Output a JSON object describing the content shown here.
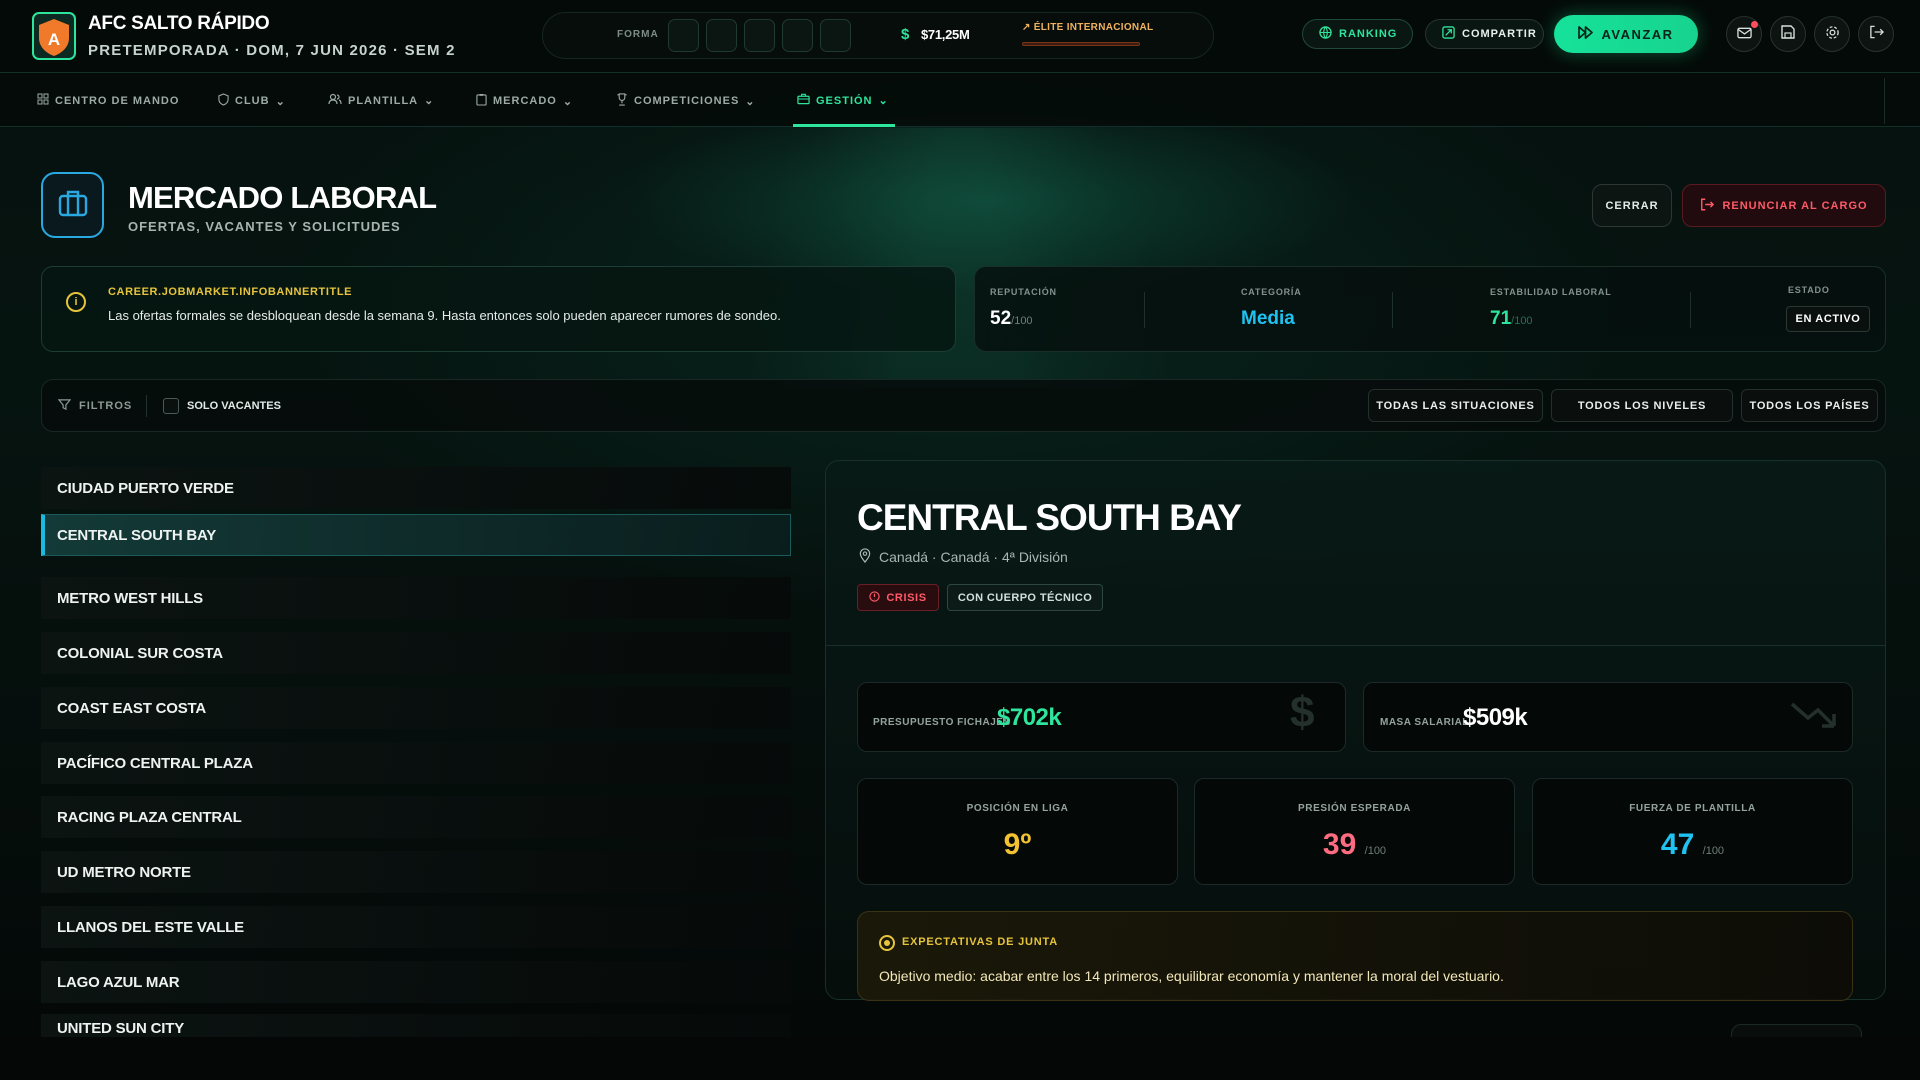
{
  "header": {
    "club_name": "AFC SALTO RÁPIDO",
    "logo_letter": "A",
    "subtitle": "PRETEMPORADA · DOM, 7 JUN 2026 · SEM 2",
    "forma_label": "FORMA",
    "forma_boxes": [
      "",
      "",
      "",
      "",
      ""
    ],
    "money": "$71,25M",
    "elite_label": "ÉLITE INTERNACIONAL",
    "ranking_label": "RANKING",
    "share_label": "COMPARTIR",
    "advance_label": "AVANZAR"
  },
  "nav": {
    "items": [
      {
        "label": "CENTRO DE MANDO",
        "icon": "grid-icon"
      },
      {
        "label": "CLUB",
        "icon": "shield-icon"
      },
      {
        "label": "PLANTILLA",
        "icon": "users-icon"
      },
      {
        "label": "MERCADO",
        "icon": "clipboard-icon"
      },
      {
        "label": "COMPETICIONES",
        "icon": "trophy-icon"
      },
      {
        "label": "GESTIÓN",
        "icon": "briefcase-icon"
      }
    ],
    "active": "GESTIÓN"
  },
  "page": {
    "title": "MERCADO LABORAL",
    "subtitle": "OFERTAS, VACANTES Y SOLICITUDES",
    "close_label": "CERRAR",
    "resign_label": "RENUNCIAR AL CARGO"
  },
  "info_banner": {
    "title": "CAREER.JOBMARKET.INFOBANNERTITLE",
    "text": "Las ofertas formales se desbloquean desde la semana 9. Hasta entonces solo pueden aparecer rumores de sondeo."
  },
  "stats": {
    "reputation_label": "REPUTACIÓN",
    "reputation_value": "52",
    "reputation_max": "/100",
    "category_label": "CATEGORÍA",
    "category_value": "Media",
    "stability_label": "ESTABILIDAD LABORAL",
    "stability_value": "71",
    "stability_max": "/100",
    "state_label": "ESTADO",
    "state_value": "EN ACTIVO"
  },
  "filters": {
    "label": "FILTROS",
    "vacancies_only": "SOLO VACANTES",
    "situations": "TODAS LAS SITUACIONES",
    "levels": "TODOS LOS NIVELES",
    "countries": "TODOS LOS PAÍSES"
  },
  "clubs": [
    "CIUDAD PUERTO VERDE",
    "CENTRAL SOUTH BAY",
    "METRO WEST HILLS",
    "COLONIAL SUR COSTA",
    "COAST EAST COSTA",
    "PACÍFICO CENTRAL PLAZA",
    "RACING PLAZA CENTRAL",
    "UD METRO NORTE",
    "LLANOS DEL ESTE VALLE",
    "LAGO AZUL MAR",
    "UNITED SUN CITY"
  ],
  "selected_club_index": 1,
  "detail": {
    "name": "CENTRAL SOUTH BAY",
    "location": "Canadá · Canadá · 4ª División",
    "tag_crisis": "CRISIS",
    "tag_staff": "CON CUERPO TÉCNICO",
    "budget_label": "PRESUPUESTO FICHAJES",
    "budget_value": "$702k",
    "wages_label": "MASA SALARIAL",
    "wages_value": "$509k",
    "league_pos_label": "POSICIÓN EN LIGA",
    "league_pos_value": "9º",
    "pressure_label": "PRESIÓN ESPERADA",
    "pressure_value": "39",
    "pressure_max": "/100",
    "squad_label": "FUERZA DE PLANTILLA",
    "squad_value": "47",
    "squad_max": "/100",
    "expect_title": "EXPECTATIVAS DE JUNTA",
    "expect_text": "Objetivo medio: acabar entre los 14 primeros, equilibrar economía y mantener la moral del vestuario."
  },
  "colors": {
    "accent_green": "#2ee59d",
    "accent_blue": "#19b9e0",
    "accent_yellow": "#e6c43c",
    "accent_red": "#ff5a68",
    "pressure_pink": "#ff6b80",
    "squad_cyan": "#1fc2f0"
  }
}
